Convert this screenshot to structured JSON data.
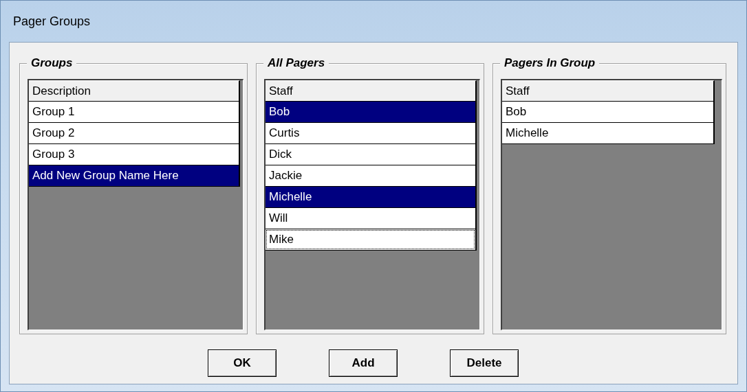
{
  "window": {
    "title": "Pager Groups"
  },
  "panels": [
    {
      "title": "Groups",
      "header": "Description",
      "rows": [
        {
          "text": "Group 1",
          "selected": false,
          "focused": false
        },
        {
          "text": "Group 2",
          "selected": false,
          "focused": false
        },
        {
          "text": "Group 3",
          "selected": false,
          "focused": false
        },
        {
          "text": "Add New Group Name Here",
          "selected": true,
          "focused": false
        }
      ]
    },
    {
      "title": "All Pagers",
      "header": "Staff",
      "rows": [
        {
          "text": "Bob",
          "selected": true,
          "focused": false
        },
        {
          "text": "Curtis",
          "selected": false,
          "focused": false
        },
        {
          "text": "Dick",
          "selected": false,
          "focused": false
        },
        {
          "text": "Jackie",
          "selected": false,
          "focused": false
        },
        {
          "text": "Michelle",
          "selected": true,
          "focused": false
        },
        {
          "text": "Will",
          "selected": false,
          "focused": false
        },
        {
          "text": "Mike",
          "selected": false,
          "focused": true
        }
      ]
    },
    {
      "title": "Pagers In Group",
      "header": "Staff",
      "rows": [
        {
          "text": "Bob",
          "selected": false,
          "focused": false
        },
        {
          "text": "Michelle",
          "selected": false,
          "focused": false
        }
      ]
    }
  ],
  "buttons": [
    "OK",
    "Add",
    "Delete"
  ]
}
